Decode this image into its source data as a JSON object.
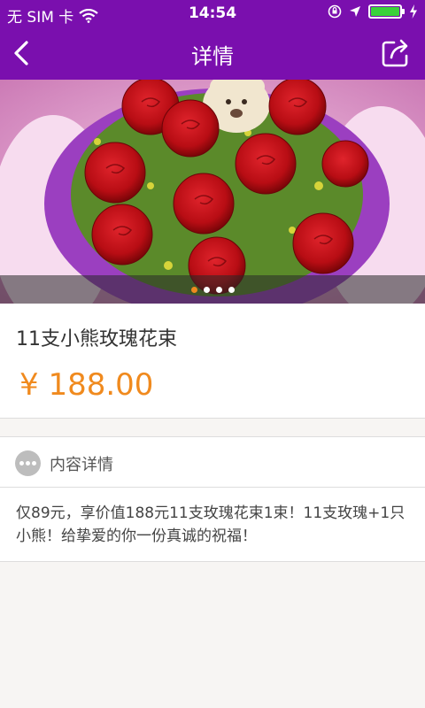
{
  "status_bar": {
    "carrier": "无 SIM 卡",
    "time": "14:54",
    "battery_level": 1.0,
    "icons": [
      "wifi-icon",
      "orientation-lock-icon",
      "location-icon",
      "battery-icon",
      "charging-icon"
    ]
  },
  "nav": {
    "title": "详情",
    "back_icon": "chevron-left-icon",
    "share_icon": "share-icon"
  },
  "banner": {
    "slide_count": 4,
    "active_index": 0
  },
  "product": {
    "title": "11支小熊玫瑰花束",
    "price": "¥ 188.00"
  },
  "detail": {
    "label": "内容详情",
    "description": "仅89元，享价值188元11支玫瑰花束1束！11支玫瑰+1只小熊！给挚爱的你一份真诚的祝福！"
  },
  "colors": {
    "header": "#7a0fae",
    "accent": "#f08a1e",
    "background": "#f7f5f3"
  }
}
